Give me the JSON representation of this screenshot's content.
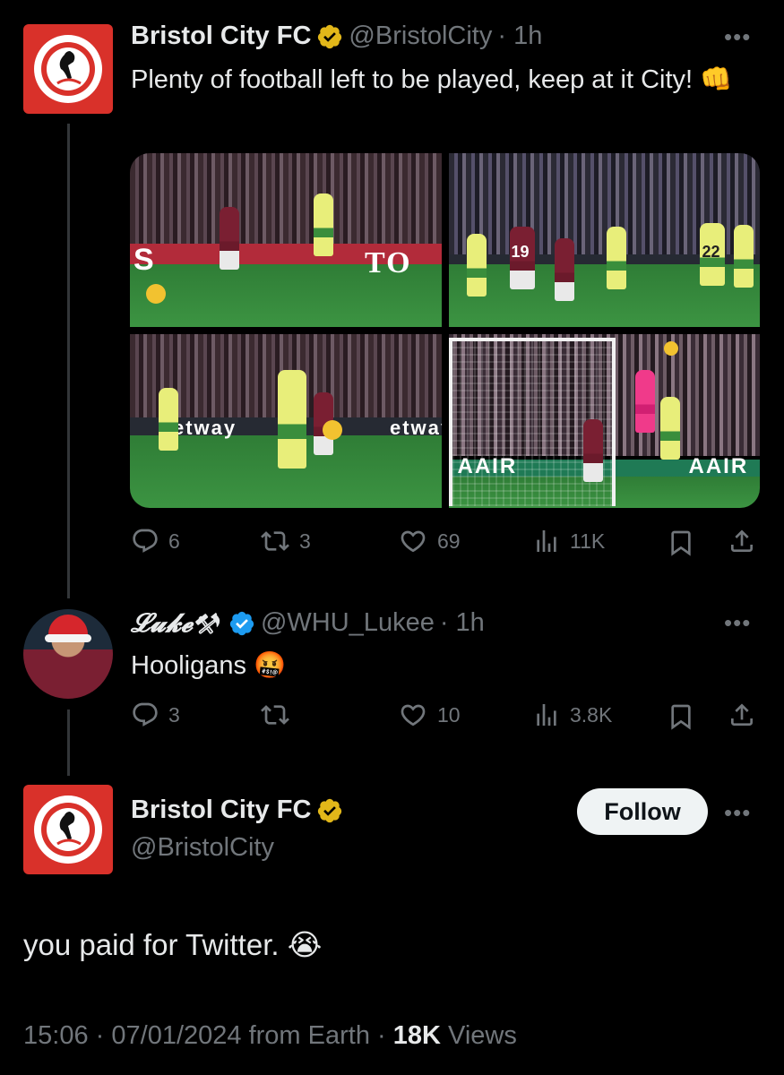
{
  "colors": {
    "background": "#000000",
    "primary_text": "#e7e9ea",
    "secondary_text": "#71767b",
    "club_red": "#d9312a",
    "verified_gold": "#e2b719",
    "verified_blue": "#1d9bf0",
    "thread_line": "#333639"
  },
  "tweet1": {
    "avatar": "bristol-city-crest-icon",
    "name": "Bristol City FC",
    "handle": "@BristolCity",
    "time": "· 1h",
    "text": "Plenty of football left to be played, keep at it City! 👊",
    "media": [
      {
        "alt": "photo-1"
      },
      {
        "alt": "photo-2"
      },
      {
        "alt": "photo-3"
      },
      {
        "alt": "photo-4"
      }
    ],
    "media_text": {
      "board_1": "S",
      "board_1b": "TO",
      "shirt_19": "19",
      "shirt_22": "22",
      "board_3a": "etway",
      "board_3b": "etway",
      "board_4a": "AAIR",
      "board_4b": "AAIR"
    },
    "actions": {
      "replies": "6",
      "reposts": "3",
      "likes": "69",
      "views": "11K"
    }
  },
  "tweet2": {
    "name": "𝓛𝓾𝓴𝓮⚒",
    "handle": "@WHU_Lukee",
    "time": "· 1h",
    "text": "Hooligans 🤬",
    "actions": {
      "replies": "3",
      "reposts": "",
      "likes": "10",
      "views": "3.8K"
    }
  },
  "tweet3": {
    "name": "Bristol City FC",
    "handle": "@BristolCity",
    "follow_label": "Follow",
    "text": "you paid for Twitter. 😭",
    "time": "15:06",
    "date": "07/01/2024",
    "source": "from Earth",
    "views_count": "18K",
    "views_label": "Views",
    "sep": "·"
  }
}
